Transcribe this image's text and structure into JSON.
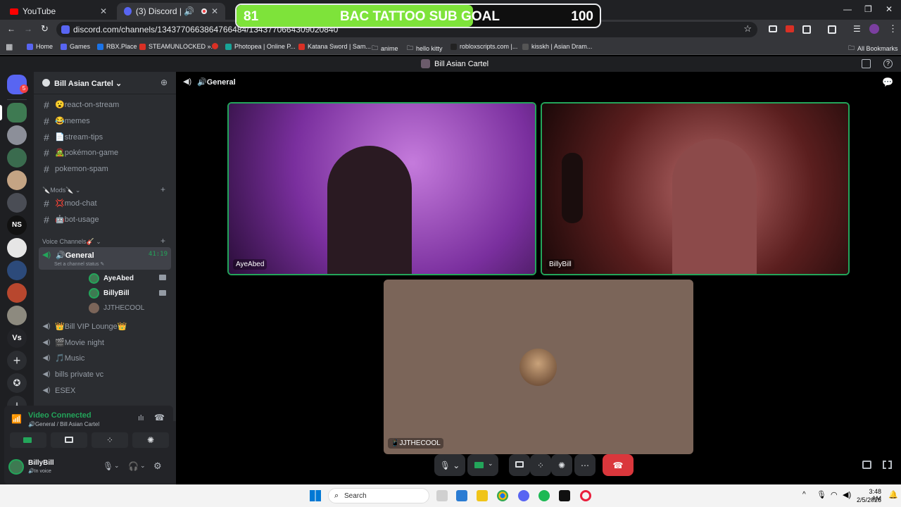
{
  "browser": {
    "tabs": [
      {
        "title": "YouTube",
        "close": "✕"
      },
      {
        "title": "(3) Discord | 🔊 General | Bi",
        "close": "✕"
      }
    ],
    "new_tab": "+",
    "window_controls": [
      "—",
      "❐",
      "✕"
    ],
    "url": "discord.com/channels/1343770663864766484/1343770664309020840",
    "bookmarks": [
      "Home",
      "Games",
      "RBX.Place",
      "STEAMUNLOCKED »...",
      "Photopea | Online P...",
      "Katana Sword | Sam...",
      "anime",
      "hello kitty",
      "robloxscripts.com |...",
      "kisskh | Asian Dram...",
      "All Bookmarks"
    ]
  },
  "overlay_goal": {
    "current": "81",
    "label": "BAC TATTOO SUB GOAL",
    "target": "100",
    "progress": 0.81,
    "fill_color": "#7ee33a"
  },
  "discord": {
    "window_title": "Bill Asian Cartel",
    "home_badge": "5",
    "guild_labels": [
      "NS",
      "Vs"
    ],
    "server": {
      "name": "Bill Asian Cartel ⌄"
    },
    "text_channels": [
      "😮react-on-stream",
      "😂memes",
      "📄stream-tips",
      "🧟pokémon-game",
      "pokemon-spam"
    ],
    "categories": {
      "mods": "🔪Mods🔪 ⌄",
      "voice": "Voice Channels🎸 ⌄"
    },
    "mod_channels": [
      "💢mod-chat",
      "🤖bot-usage"
    ],
    "active_voice": {
      "name": "🔊General",
      "timer": "41:19",
      "status_hint": "Set a channel status ✎"
    },
    "members": [
      "AyeAbed",
      "BillyBill",
      "JJTHECOOL"
    ],
    "other_voice": [
      "👑Bill VIP Lounge👑",
      "🎬Movie night",
      "🎵Music",
      "bills private vc",
      "ESEX"
    ],
    "connection": {
      "status": "Video Connected",
      "location": "🔊General / Bill Asian Cartel"
    },
    "user": {
      "name": "BillyBill",
      "status": "🔊In voice"
    },
    "stage_header": "🔊General",
    "tiles": [
      {
        "name": "AyeAbed",
        "color": "#7a2f9e"
      },
      {
        "name": "BillyBill",
        "color": "#5a1e1e"
      },
      {
        "name": "📱JJTHECOOL",
        "color": "#7b6559"
      }
    ]
  },
  "taskbar": {
    "search_placeholder": "Search",
    "time": "3:48 AM",
    "date": "2/5/2026"
  }
}
